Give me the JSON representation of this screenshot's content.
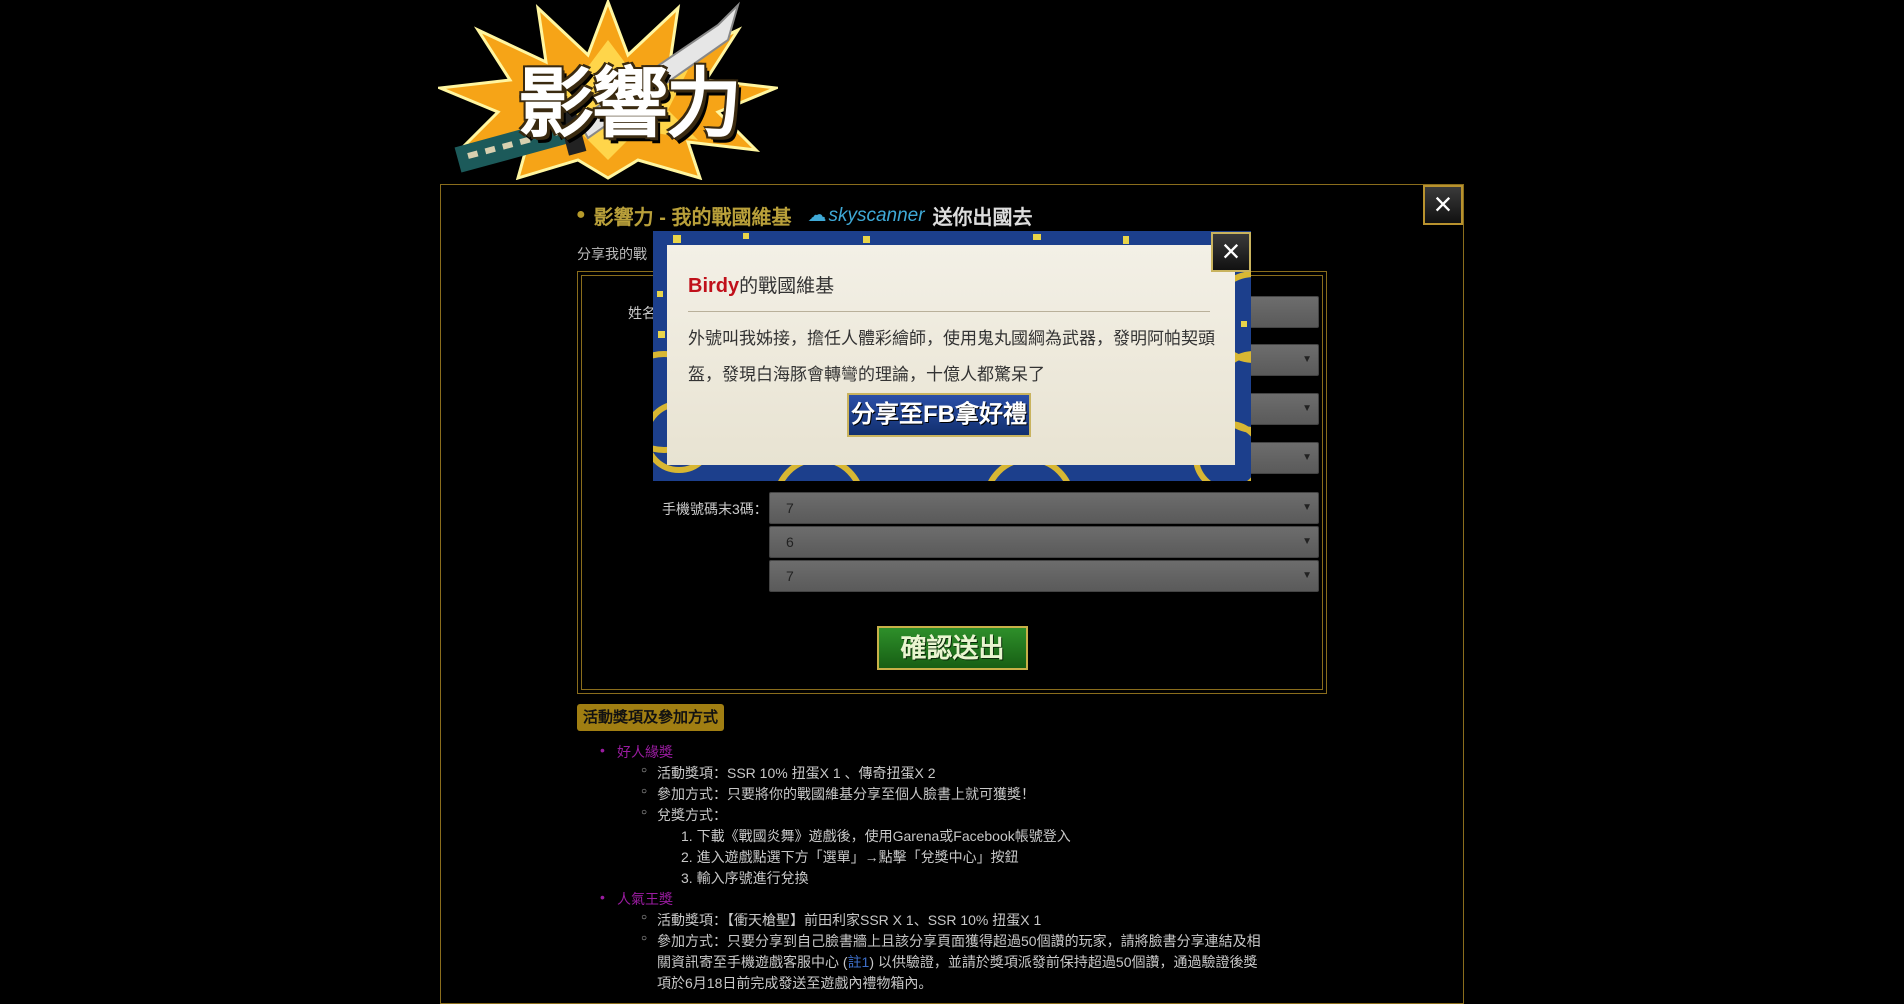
{
  "logo": {
    "text": "影響力"
  },
  "page": {
    "title": "影響力 - 我的戰國維基",
    "sponsor_logo": "skyscanner",
    "title_suffix": "送你出國去",
    "subtitle": "分享我的戰",
    "close_icon": "×"
  },
  "form": {
    "name_label": "姓名",
    "phone_label": "手機號碼末3碼：",
    "phone_digits": [
      "7",
      "6",
      "7"
    ],
    "submit_label": "確認送出"
  },
  "rules": {
    "section_title": "活動獎項及參加方式",
    "award1": {
      "name": "好人緣獎",
      "prize": "活動獎項：SSR 10% 扭蛋X 1 、傳奇扭蛋X 2",
      "method": "參加方式：只要將你的戰國維基分享至個人臉書上就可獲獎！",
      "redeem": "兌獎方式：",
      "steps": [
        "1. 下載《戰國炎舞》遊戲後，使用Garena或Facebook帳號登入",
        "2. 進入遊戲點選下方「選單」→點擊「兌獎中心」按鈕",
        "3. 輸入序號進行兌換"
      ]
    },
    "award2": {
      "name": "人氣王獎",
      "prize": "活動獎項：【衝天槍聖】前田利家SSR X 1、SSR 10% 扭蛋X 1",
      "method_l1": "參加方式：只要分享到自己臉書牆上且該分享頁面獲得超過50個讚的玩家，請將臉書分享連結及相",
      "method_l2a": "關資訊寄至手機遊戲客服中心 (",
      "method_link": "註1",
      "method_l2b": ") 以供驗證，並請於獎項派發前保持超過50個讚，通過驗證後獎",
      "method_l3": "項於6月18日前完成發送至遊戲內禮物箱內。"
    }
  },
  "modal": {
    "name": "Birdy",
    "title_suffix": "的戰國維基",
    "description": "外號叫我姊接，擔任人體彩繪師，使用鬼丸國綱為武器，發明阿帕契頭盔，發現白海豚會轉彎的理論，十億人都驚呆了",
    "share_button": "分享至FB拿好禮",
    "close_icon": "×"
  },
  "colors": {
    "accent_gold": "#8a6d1c",
    "award_purple": "#9a1ca0",
    "modal_blue": "#1c3f8c",
    "name_red": "#c0101a"
  }
}
